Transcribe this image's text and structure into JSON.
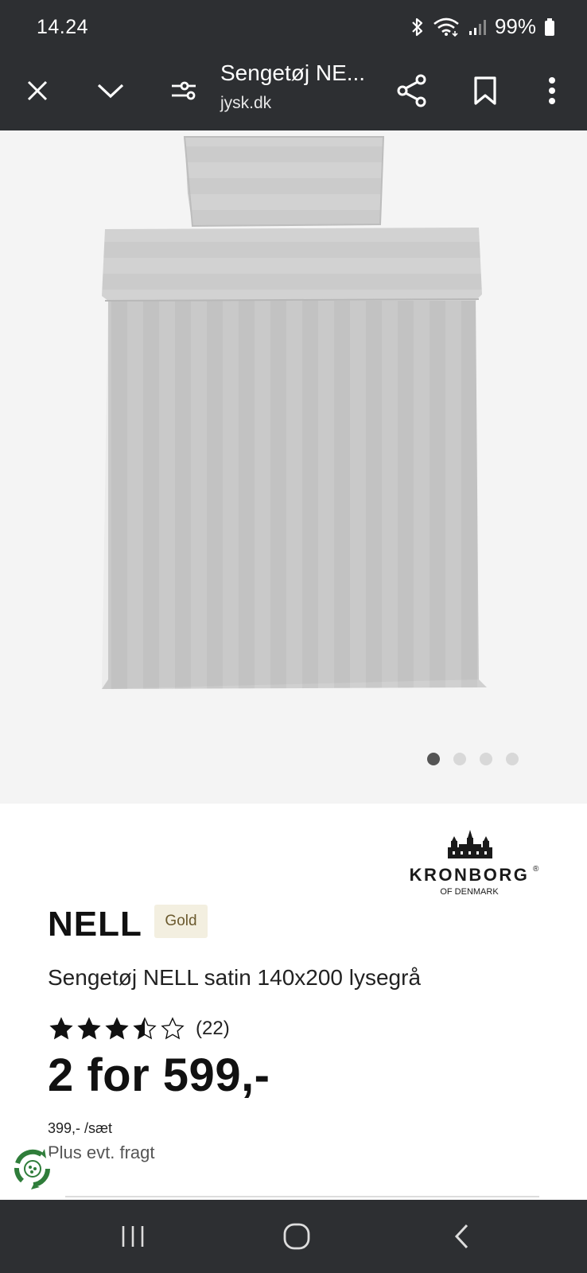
{
  "status_bar": {
    "time": "14.24",
    "battery": "99%",
    "icons": [
      "bluetooth-icon",
      "wifi-icon",
      "signal-icon",
      "battery-icon"
    ]
  },
  "toolbar": {
    "title": "Sengetøj NE...",
    "url": "jysk.dk",
    "icons": [
      "close-icon",
      "chevron-down-icon",
      "tune-icon",
      "share-icon",
      "bookmark-icon",
      "more-vert-icon"
    ]
  },
  "gallery": {
    "image_count": 4,
    "active_index": 0
  },
  "brand": {
    "name": "KRONBORG",
    "registered": "®",
    "tagline": "OF DENMARK"
  },
  "product": {
    "name": "NELL",
    "badge": "Gold",
    "description": "Sengetøj NELL satin 140x200 lysegrå",
    "rating": 3.5,
    "rating_max": 5,
    "review_count": "(22)",
    "price": "2 for 599,-",
    "unit_price": "399,- /sæt",
    "shipping": "Plus evt. fragt"
  },
  "colors": {
    "system_bar": "#2d2f32",
    "image_bg": "#f4f4f4",
    "badge_bg": "#f3efe0",
    "badge_text": "#6b5a2e",
    "eco_green": "#2f7d3a"
  },
  "nav": {
    "icons": [
      "recent-apps-icon",
      "home-icon",
      "back-icon"
    ]
  }
}
